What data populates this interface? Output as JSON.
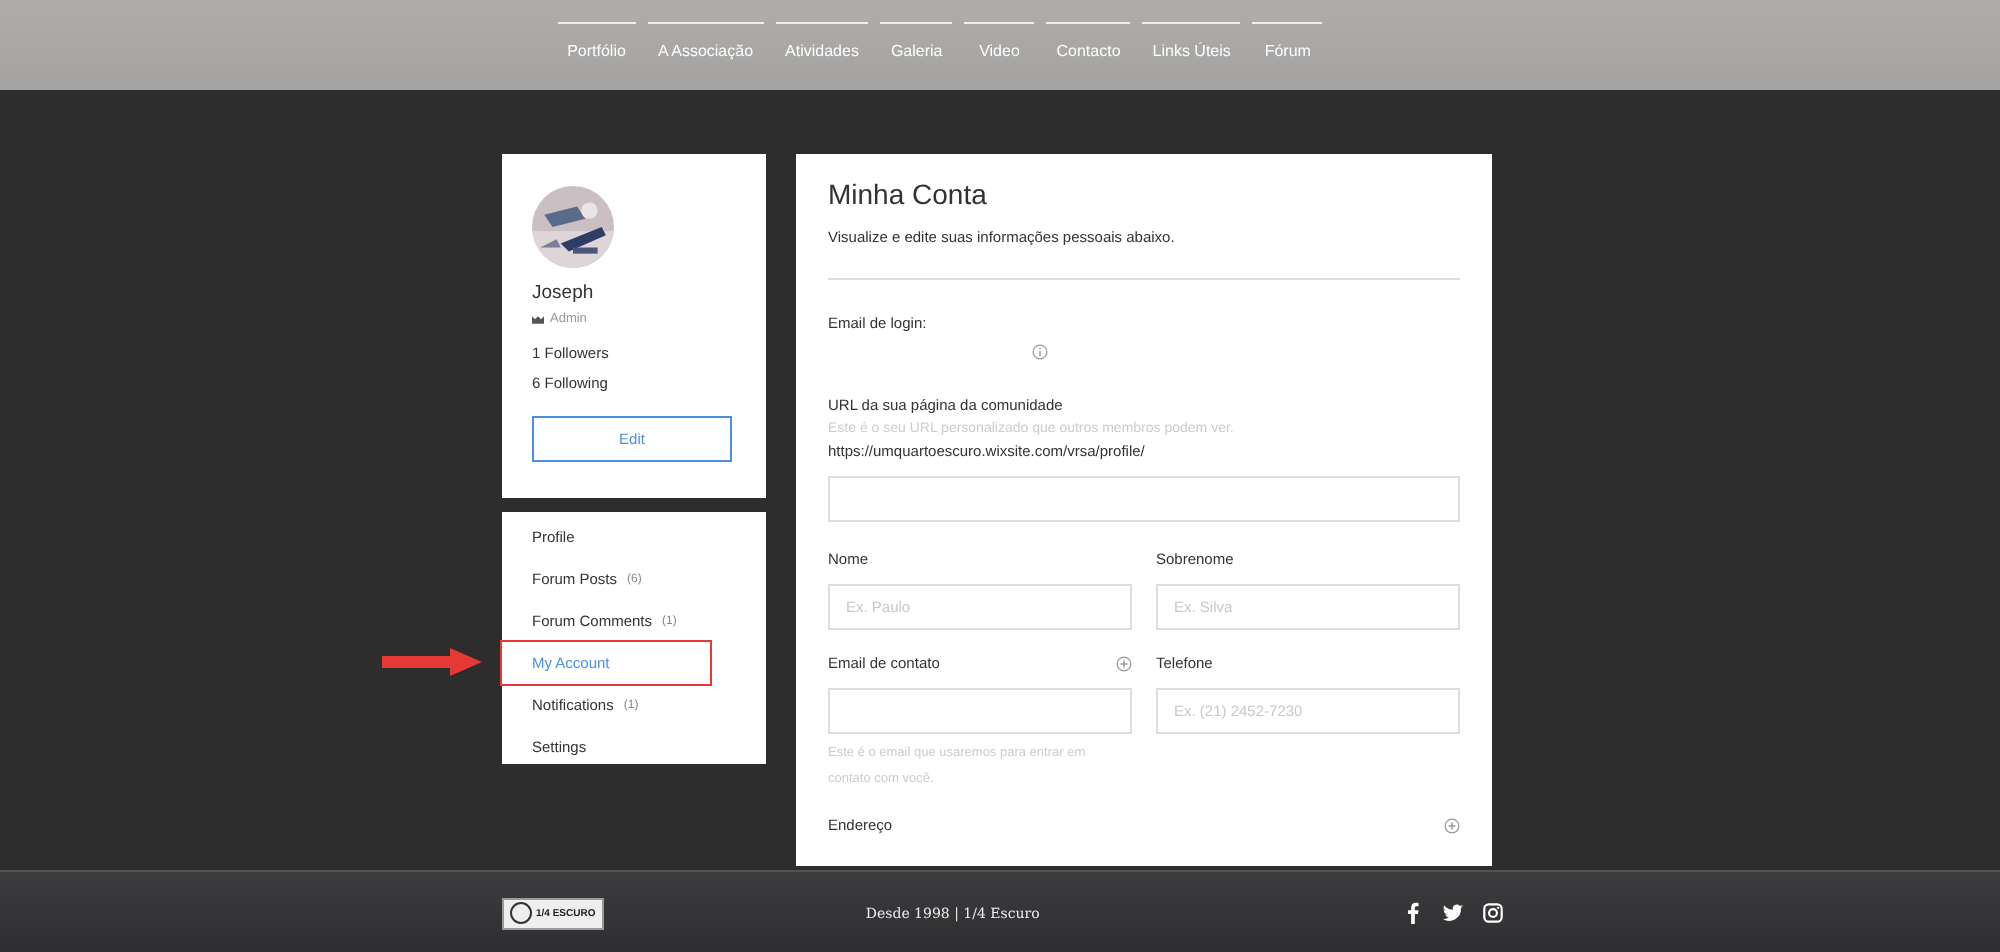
{
  "nav": {
    "items": [
      {
        "label": "Portfólio"
      },
      {
        "label": "A Associação"
      },
      {
        "label": "Atividades"
      },
      {
        "label": "Galeria"
      },
      {
        "label": "Video"
      },
      {
        "label": "Contacto"
      },
      {
        "label": "Links Úteis"
      },
      {
        "label": "Fórum"
      }
    ]
  },
  "profile": {
    "name": "Joseph",
    "role": "Admin",
    "followers": "1 Followers",
    "following": "6 Following",
    "edit_button": "Edit"
  },
  "menu": {
    "items": [
      {
        "label": "Profile",
        "selected": false,
        "highlighted": false
      },
      {
        "label": "Forum Posts",
        "count": "(6)",
        "selected": false,
        "highlighted": false
      },
      {
        "label": "Forum Comments",
        "count": "(1)",
        "selected": false,
        "highlighted": false
      },
      {
        "label": "My Account",
        "selected": true,
        "highlighted": true
      },
      {
        "label": "Notifications",
        "count": "(1)",
        "selected": false,
        "highlighted": false
      },
      {
        "label": "Settings",
        "selected": false,
        "highlighted": false
      }
    ]
  },
  "account": {
    "title": "Minha Conta",
    "subtitle": "Visualize e edite suas informações pessoais abaixo.",
    "login_email_label": "Email de login:",
    "url_label": "URL da sua página da comunidade",
    "url_hint": "Este é o seu URL personalizado que outros membros podem ver.",
    "url_prefix": "https://umquartoescuro.wixsite.com/vrsa/profile/",
    "fields": [
      {
        "label": "Nome",
        "placeholder": "Ex. Paulo"
      },
      {
        "label": "Sobrenome",
        "placeholder": "Ex. Silva"
      },
      {
        "label": "Email de contato",
        "hint": "Este é o email que usaremos para entrar em contato com você.",
        "addable": true
      },
      {
        "label": "Telefone",
        "placeholder": "Ex. (21) 2452-7230"
      }
    ],
    "address_label": "Endereço"
  },
  "footer": {
    "logo_text": "1/4 ESCURO",
    "text": "Desde 1998 | 1/4 Escuro"
  }
}
